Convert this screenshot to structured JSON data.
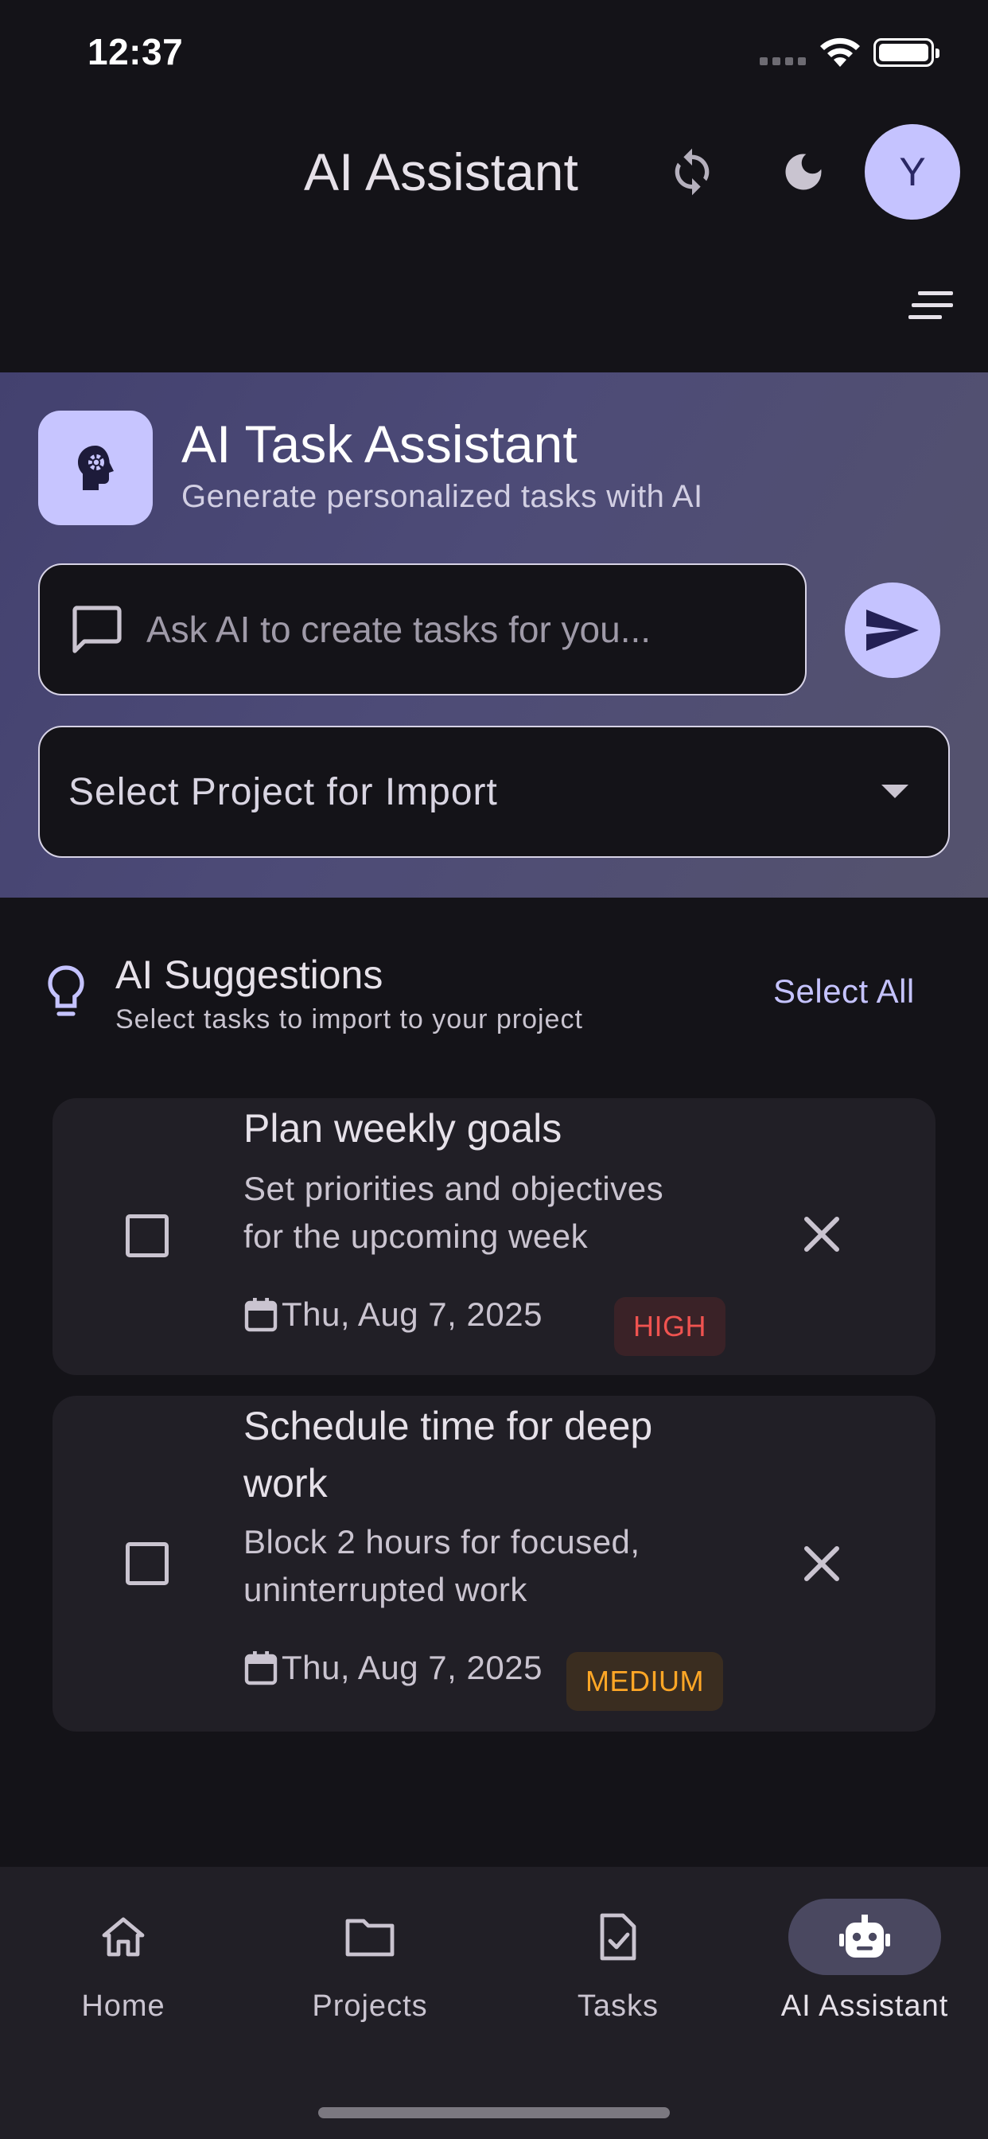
{
  "status_bar": {
    "time": "12:37"
  },
  "app_bar": {
    "title": "AI Assistant",
    "avatar_initial": "Y"
  },
  "hero": {
    "title": "AI Task Assistant",
    "subtitle": "Generate personalized tasks with AI",
    "prompt": {
      "placeholder": "Ask AI to create tasks for you...",
      "value": ""
    },
    "project_select": {
      "label": "Select Project for Import"
    }
  },
  "suggestions": {
    "title": "AI Suggestions",
    "subtitle": "Select tasks to import to your project",
    "select_all": "Select All",
    "items": [
      {
        "title": "Plan weekly goals",
        "description_lines": [
          "Set priorities and objectives",
          "for the upcoming week"
        ],
        "date": "Thu, Aug 7, 2025",
        "priority": "HIGH",
        "checked": false
      },
      {
        "title_lines": [
          "Schedule time for deep",
          "work"
        ],
        "description_lines": [
          "Block 2 hours for focused,",
          "uninterrupted work"
        ],
        "date": "Thu, Aug 7, 2025",
        "priority": "MEDIUM",
        "checked": false
      }
    ]
  },
  "bottom_nav": {
    "items": [
      {
        "label": "Home",
        "icon": "home-icon"
      },
      {
        "label": "Projects",
        "icon": "folder-icon"
      },
      {
        "label": "Tasks",
        "icon": "task-icon"
      },
      {
        "label": "AI Assistant",
        "icon": "robot-icon",
        "active": true
      }
    ]
  },
  "colors": {
    "background": "#141318",
    "accent": "#c5c3ff",
    "high_priority": "#ef5350",
    "medium_priority": "#ffa726"
  }
}
